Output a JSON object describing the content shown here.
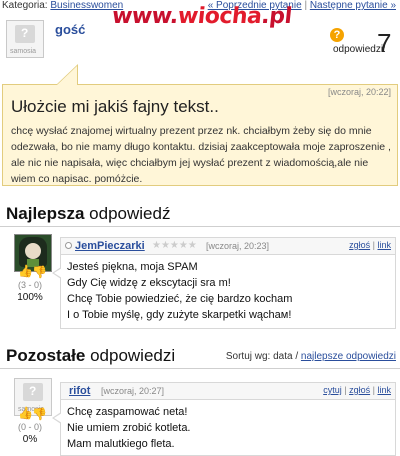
{
  "topbar": {
    "category_label": "Kategoria:",
    "category_value": "Businesswomen",
    "prev_link": "« Poprzednie pytanie",
    "separator": "|",
    "next_link": "Następne pytanie »"
  },
  "watermark": {
    "text_red": "www.",
    "text_main": "wiocha",
    "text_end": ".pl"
  },
  "asker": {
    "avatar_label": "samosia",
    "name": "gość"
  },
  "answers_summary": {
    "badge": "?",
    "label": "odpowiedzi:",
    "count": "7"
  },
  "question": {
    "date": "[wczoraj, 20:22]",
    "title": "Ułożcie mi jakiś fajny tekst..",
    "body": "chcę wysłać znajomej wirtualny prezent przez nk. chciałbym żeby się do mnie odezwała, bo nie mamy długo kontaktu. dzisiaj zaakceptowała moje zaproszenie , ale nic nie napisała, więc chciałbym jej wysłać prezent z wiadomością,ale nie wiem co napisac. pomóżcie."
  },
  "best": {
    "section_bold": "Najlepsza",
    "section_rest": " odpowiedź",
    "name": "JemPieczarki",
    "stars": "★★★★★",
    "date": "[wczoraj, 20:23]",
    "action_report": "zgłoś",
    "action_sep": "|",
    "action_link": "link",
    "lines": [
      "Jesteś piękna, moja SPAM",
      "Gdy Cię widzę z ekscytacji sra m!",
      "Chcę Tobie powiedzieć, że cię bardzo kocham",
      "I o Tobie myślę, gdy zużyte skarpetki wąchам!"
    ],
    "score": "(3 - 0)",
    "percent": "100%"
  },
  "others": {
    "section_bold": "Pozostałe",
    "section_rest": " odpowiedzi",
    "sort_label": "Sortuj wg: data /",
    "sort_link": "najlepsze odpowiedzi",
    "answer": {
      "avatar_label": "samosia",
      "name": "rifot",
      "date": "[wczoraj, 20:27]",
      "action_quote": "cytuj",
      "action_report": "zgłoś",
      "action_link": "link",
      "action_sep": "|",
      "lines": [
        "Chcę zaspamować neta!",
        "Nie umiem zrobić kotleta.",
        "Mam malutkiego fleta."
      ],
      "score": "(0 - 0)",
      "percent": "0%"
    }
  }
}
